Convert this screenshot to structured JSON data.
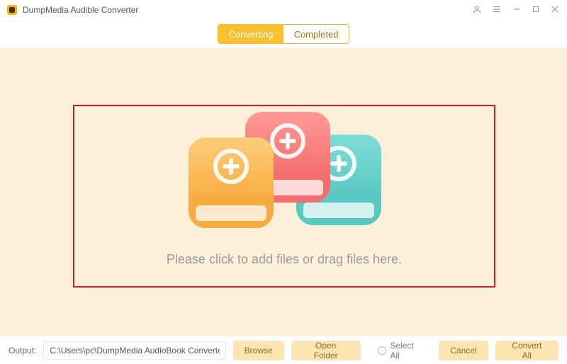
{
  "app": {
    "title": "DumpMedia Audible Converter"
  },
  "tabs": {
    "converting": "Converting",
    "completed": "Completed",
    "active": "converting"
  },
  "dropzone": {
    "hint": "Please click to add files or drag files here."
  },
  "footer": {
    "output_label": "Output:",
    "output_path": "C:\\Users\\pc\\DumpMedia AudioBook Converte",
    "browse": "Browse",
    "open_folder": "Open Folder",
    "select_all": "Select All",
    "cancel": "Cancel",
    "convert_all": "Convert All"
  }
}
